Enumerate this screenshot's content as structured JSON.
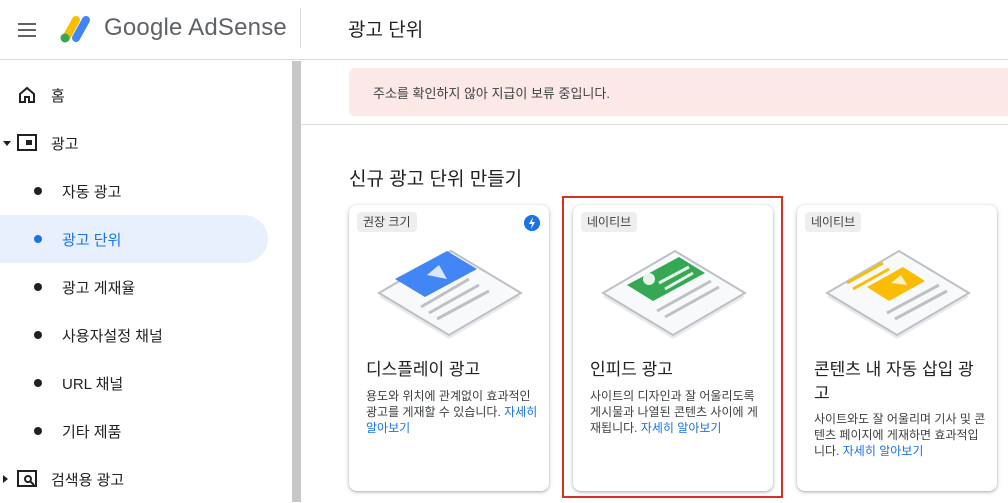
{
  "header": {
    "brand": "Google AdSense",
    "page_title": "광고 단위"
  },
  "sidebar": {
    "items": [
      {
        "label": "홈"
      },
      {
        "label": "광고"
      },
      {
        "label": "자동 광고"
      },
      {
        "label": "광고 단위"
      },
      {
        "label": "광고 게재율"
      },
      {
        "label": "사용자설정 채널"
      },
      {
        "label": "URL 채널"
      },
      {
        "label": "기타 제품"
      },
      {
        "label": "검색용 광고"
      }
    ]
  },
  "alert": {
    "text": "주소를 확인하지 않아 지급이 보류 중입니다."
  },
  "section": {
    "title": "신규 광고 단위 만들기"
  },
  "cards": [
    {
      "chip": "권장 크기",
      "title": "디스플레이 광고",
      "desc": "용도와 위치에 관계없이 효과적인 광고를 게재할 수 있습니다. ",
      "link": "자세히 알아보기",
      "accent": "#4285f4"
    },
    {
      "chip": "네이티브",
      "title": "인피드 광고",
      "desc": "사이트의 디자인과 잘 어울리도록 게시물과 나열된 콘텐츠 사이에 게재됩니다. ",
      "link": "자세히 알아보기",
      "accent": "#34a853"
    },
    {
      "chip": "네이티브",
      "title": "콘텐츠 내 자동 삽입 광고",
      "desc": "사이트와도 잘 어울리며 기사 및 콘텐츠 페이지에 게재하면 효과적입니다. ",
      "link": "자세히 알아보기",
      "accent": "#fbbc04"
    }
  ],
  "icons": {
    "menu": "menu-icon",
    "home": "home-icon",
    "ads": "ads-icon",
    "search_ads": "search-ads-icon",
    "bolt": "bolt-icon"
  },
  "colors": {
    "primary": "#1a73e8",
    "alert_bg": "#fce8e6",
    "selection_border": "#d93025"
  }
}
